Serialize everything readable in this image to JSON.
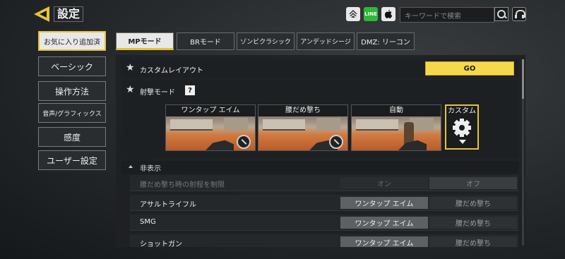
{
  "header": {
    "title": "設定",
    "search_placeholder": "キーワードで検索",
    "icons": [
      "activision-icon",
      "line-icon",
      "apple-icon",
      "search-icon",
      "support-icon"
    ],
    "line_label": "LINE"
  },
  "left_menu": {
    "items": [
      {
        "label": "お気に入り追加済",
        "active": true
      },
      {
        "label": "ベーシック"
      },
      {
        "label": "操作方法"
      },
      {
        "label": "音声/グラフィックス"
      },
      {
        "label": "感度"
      },
      {
        "label": "ユーザー設定"
      }
    ]
  },
  "tabs": [
    {
      "label": "MPモード",
      "active": true
    },
    {
      "label": "BRモード"
    },
    {
      "label": "ゾンビクラシック"
    },
    {
      "label": "アンデッドシージ"
    },
    {
      "label": "DMZ: リーコン"
    }
  ],
  "settings": {
    "custom_layout": {
      "label": "カスタムレイアウト",
      "button": "GO"
    },
    "fire_mode": {
      "label": "射撃モード",
      "help": "?",
      "modes": [
        {
          "label": "ワンタップ エイム"
        },
        {
          "label": "腰だめ撃ち"
        },
        {
          "label": "自動"
        },
        {
          "label": "カスタム",
          "selected": true
        }
      ]
    },
    "hidden_section": {
      "label": "非表示"
    },
    "options": [
      {
        "label": "腰だめ撃ち時の射程を制限",
        "disabled": true,
        "choices": [
          "オン",
          "オフ"
        ],
        "selected": 1
      },
      {
        "label": "アサルトライフル",
        "choices": [
          "ワンタップ エイム",
          "腰だめ撃ち"
        ],
        "selected": 0
      },
      {
        "label": "SMG",
        "choices": [
          "ワンタップ エイム",
          "腰だめ撃ち"
        ],
        "selected": 0
      },
      {
        "label": "ショットガン",
        "choices": [
          "ワンタップ エイム",
          "腰だめ撃ち"
        ],
        "selected": 0
      }
    ]
  },
  "colors": {
    "accent": "#e8c23a",
    "go_button": "#f5d94a",
    "line_green": "#2fb63b"
  }
}
